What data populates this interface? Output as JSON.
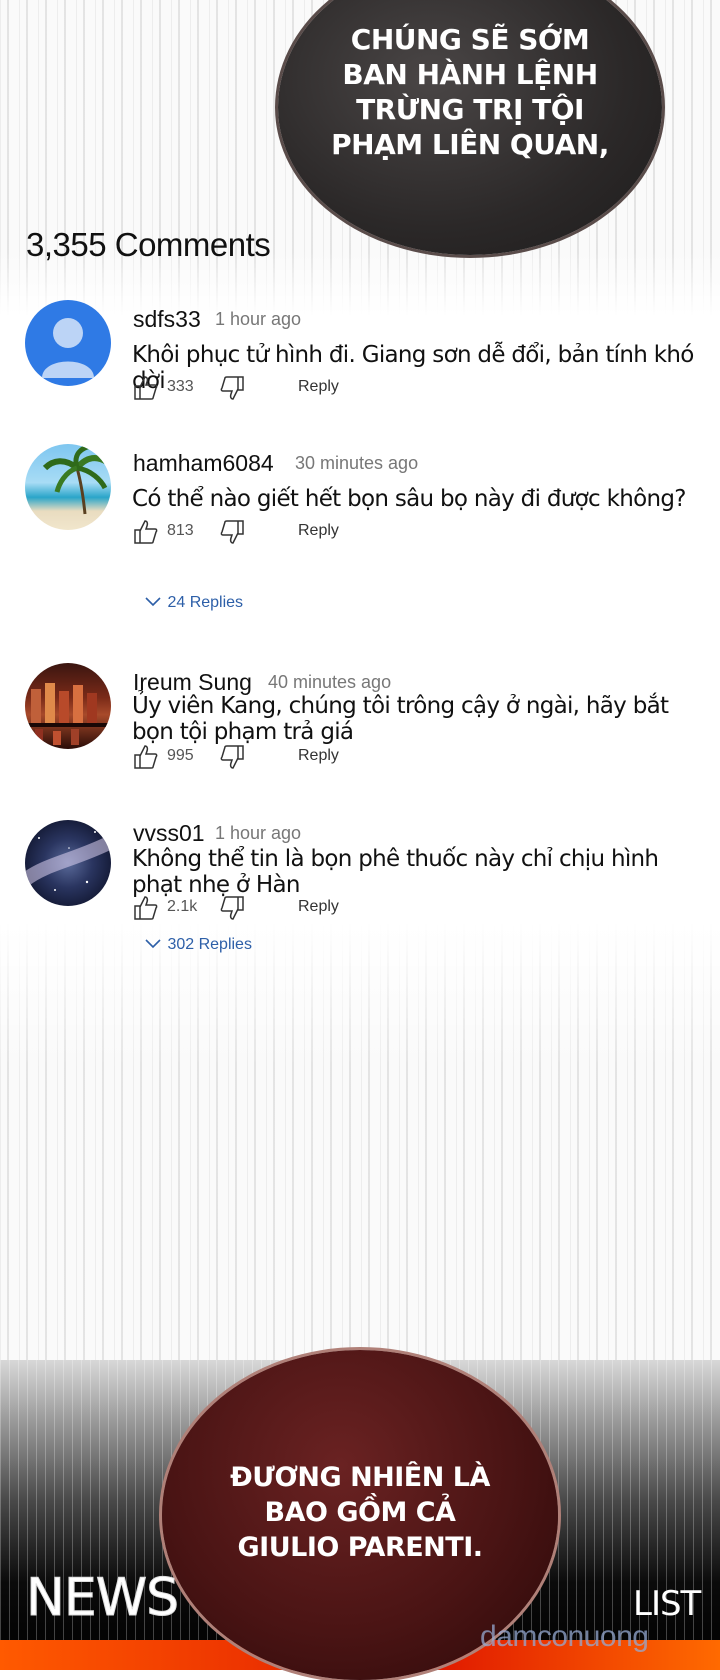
{
  "bubble_top": {
    "lines": [
      "CHÚNG SẼ SỚM",
      "BAN HÀNH LỆNH",
      "TRỪNG TRỊ TỘI",
      "PHẠM LIÊN QUAN,"
    ]
  },
  "comments_header": "3,355 Comments",
  "comments": [
    {
      "username": "sdfs33",
      "time": "1 hour ago",
      "text": "Khôi phục tử hình đi. Giang sơn dễ đổi, bản tính khó dời",
      "likes": "333",
      "reply_label": "Reply",
      "avatar": "default-person-icon"
    },
    {
      "username": "hamham6084",
      "time": "30 minutes ago",
      "text": "Có thể nào giết hết bọn sâu bọ này đi được không?",
      "likes": "813",
      "reply_label": "Reply",
      "replies": "24 Replies",
      "avatar": "beach-palm-photo"
    },
    {
      "username": "Ireum Sung",
      "time": "40 minutes ago",
      "text": "Ủy viên Kang, chúng tôi trông cậy ở ngài, hãy bắt bọn tội phạm trả giá",
      "likes": "995",
      "reply_label": "Reply",
      "avatar": "bar-bottles-photo"
    },
    {
      "username": "vvss01",
      "time": "1 hour ago",
      "text": "Không thể tin là bọn phê thuốc này chỉ chịu hình phạt nhẹ ở Hàn",
      "likes": "2.1k",
      "reply_label": "Reply",
      "replies": "302 Replies",
      "avatar": "night-sky-photo"
    }
  ],
  "bubble_bottom": {
    "lines": [
      "ĐƯƠNG NHIÊN LÀ",
      "BAO GỒM CẢ",
      "GIULIO PARENTI."
    ]
  },
  "footer": {
    "news": "NEWS",
    "list": "LIST",
    "watermark": "damconuong"
  },
  "colors": {
    "reply_link": "#2d5fa8",
    "top_bubble": "#2b2828",
    "bottom_bubble": "#4a1414"
  }
}
